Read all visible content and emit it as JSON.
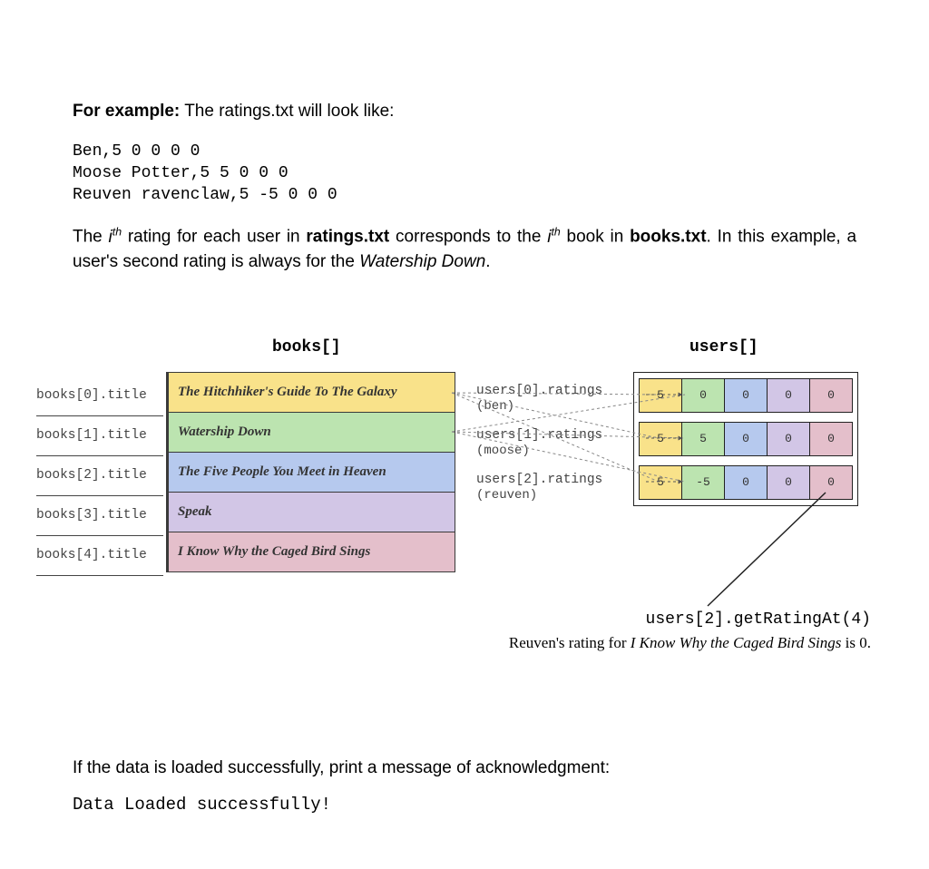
{
  "intro": {
    "prefix_bold": "For example:",
    "prefix_rest": " The ratings.txt will look like:"
  },
  "ratings_sample": "Ben,5 0 0 0 0\nMoose Potter,5 5 0 0 0\nReuven ravenclaw,5 -5 0 0 0",
  "correspondence": {
    "pre": "The ",
    "ith": "i",
    "ith_sup": "th",
    "mid1": " rating for each user in ",
    "file1": "ratings.txt",
    "mid2": " corresponds to the ",
    "file2": "books.txt",
    "mid3": ". In this example, a user's second rating is always for the ",
    "book_em": "Watership Down",
    "tail": "."
  },
  "headings": {
    "books": "books[]",
    "users": "users[]"
  },
  "books": [
    {
      "label": "books[0].title",
      "title": "The Hitchhiker's Guide To The Galaxy",
      "color": "c-yellow"
    },
    {
      "label": "books[1].title",
      "title": "Watership Down",
      "color": "c-green"
    },
    {
      "label": "books[2].title",
      "title": "The Five People You Meet in Heaven",
      "color": "c-blue"
    },
    {
      "label": "books[3].title",
      "title": "Speak",
      "color": "c-purple"
    },
    {
      "label": "books[4].title",
      "title": "I Know Why the Caged Bird Sings",
      "color": "c-rose"
    }
  ],
  "users": [
    {
      "label": "users[0].ratings",
      "sub": "(ben)",
      "ratings": [
        "5",
        "0",
        "0",
        "0",
        "0"
      ]
    },
    {
      "label": "users[1].ratings",
      "sub": "(moose)",
      "ratings": [
        "5",
        "5",
        "0",
        "0",
        "0"
      ]
    },
    {
      "label": "users[2].ratings",
      "sub": "(reuven)",
      "ratings": [
        "5",
        "-5",
        "0",
        "0",
        "0"
      ]
    }
  ],
  "rating_colors": [
    "c-yellow",
    "c-green",
    "c-blue",
    "c-purple",
    "c-rose"
  ],
  "annotation": {
    "call": "users[2].getRatingAt(4)",
    "desc_pre": "Reuven's rating for ",
    "desc_em": "I Know Why the Caged Bird Sings",
    "desc_post": " is 0."
  },
  "ack": {
    "para": "If the data is loaded successfully, print a message of acknowledgment:",
    "code": "Data Loaded successfully!"
  }
}
